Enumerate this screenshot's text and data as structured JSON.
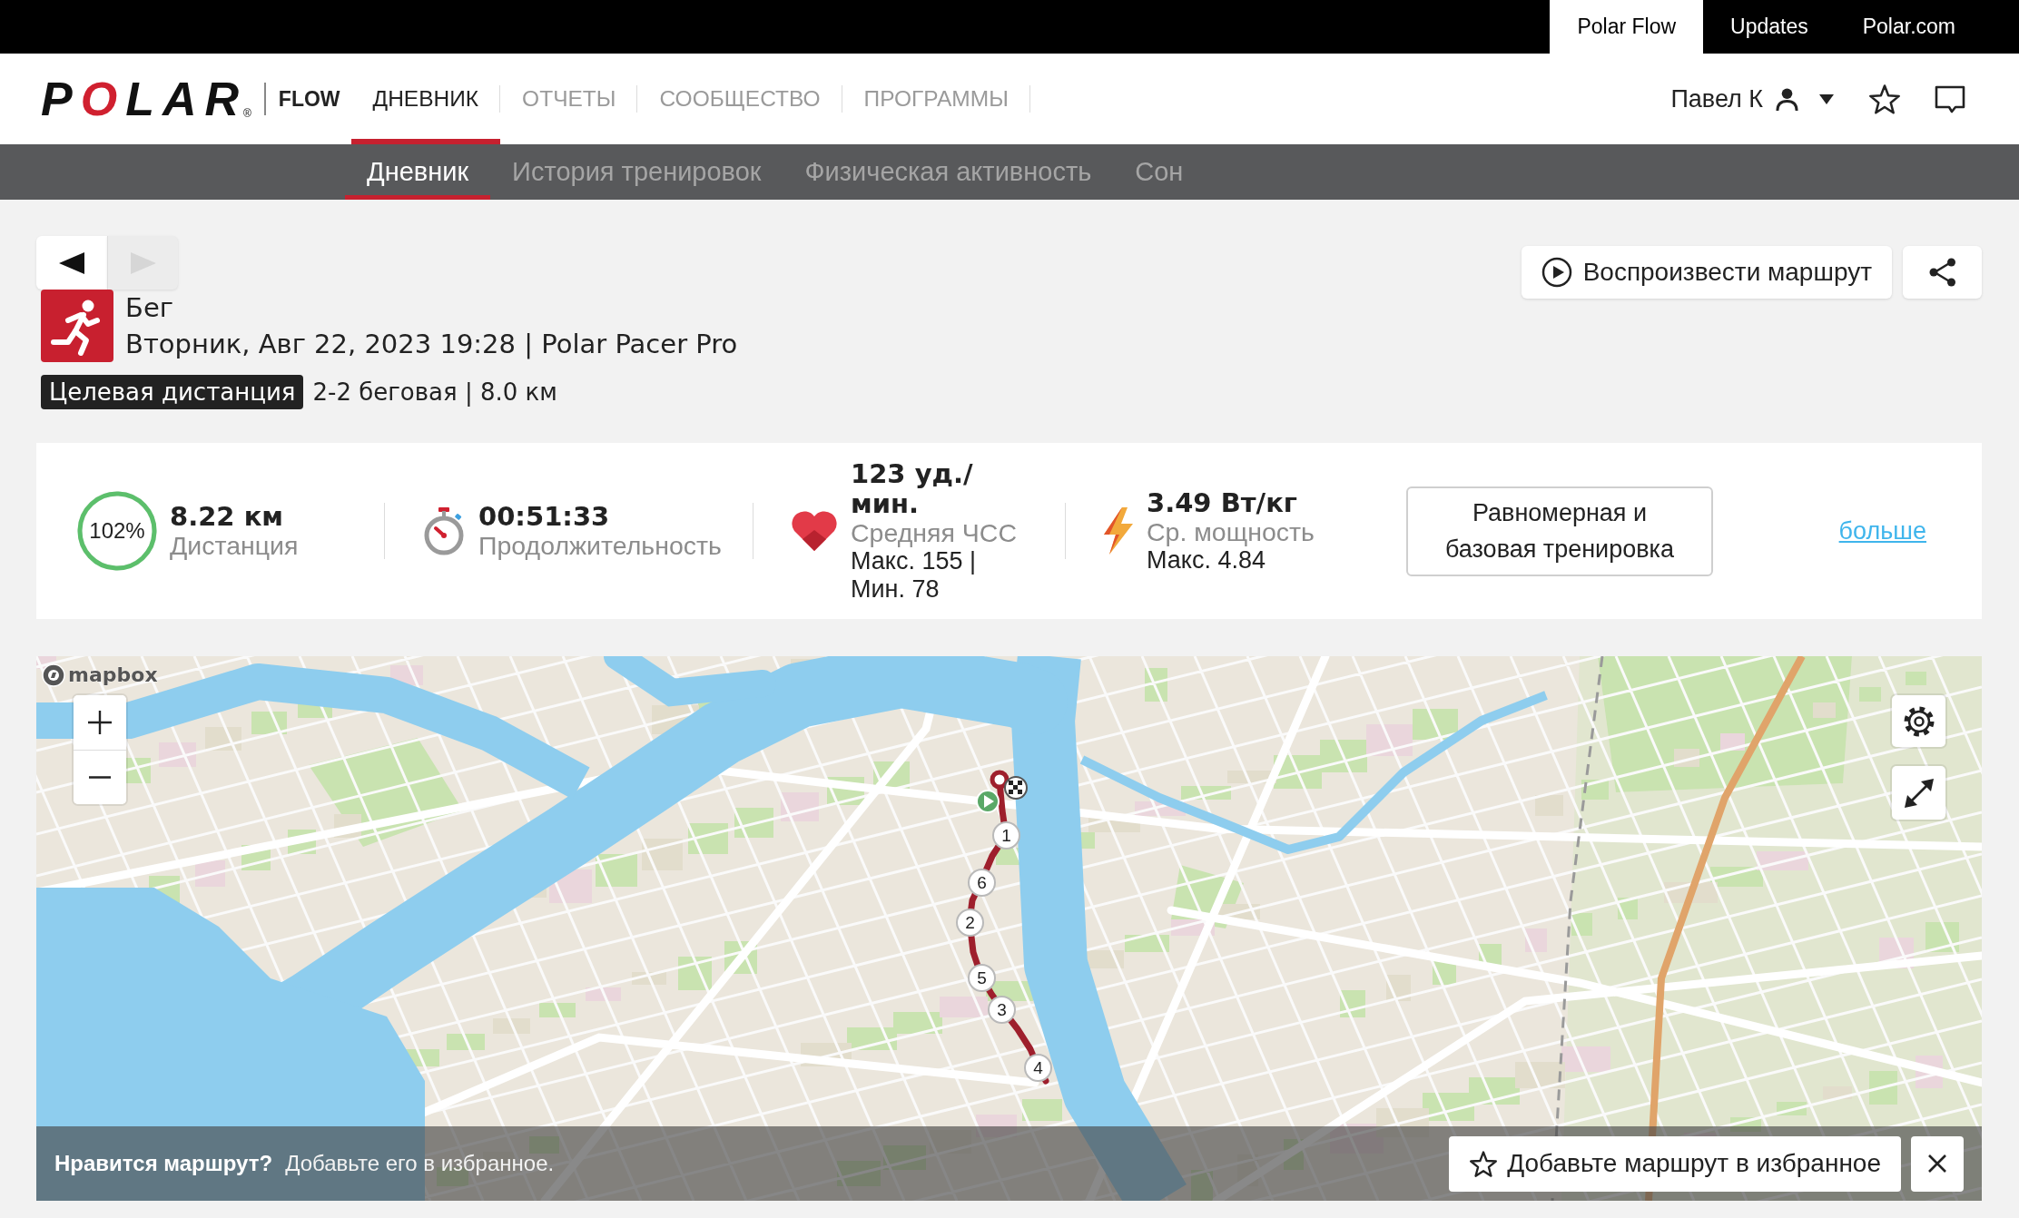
{
  "top_bar": {
    "links": [
      {
        "label": "Polar Flow",
        "selected": true
      },
      {
        "label": "Updates",
        "selected": false
      },
      {
        "label": "Polar.com",
        "selected": false
      }
    ]
  },
  "header": {
    "logo": "POLAR",
    "logo_mark": "®",
    "product": "FLOW",
    "nav": [
      {
        "label": "ДНЕВНИК",
        "selected": true
      },
      {
        "label": "ОТЧЕТЫ",
        "selected": false
      },
      {
        "label": "СООБЩЕСТВО",
        "selected": false
      },
      {
        "label": "ПРОГРАММЫ",
        "selected": false
      }
    ],
    "user": "Павел К"
  },
  "subnav": [
    {
      "label": "Дневник",
      "selected": true
    },
    {
      "label": "История тренировок",
      "selected": false
    },
    {
      "label": "Физическая активность",
      "selected": false
    },
    {
      "label": "Сон",
      "selected": false
    }
  ],
  "pager": [
    {
      "kind": "prev",
      "disabled": false
    },
    {
      "kind": "next",
      "disabled": true
    }
  ],
  "activity": {
    "sport": "Бег",
    "details": "Вторник, Авг 22, 2023 19:28 | Polar Pacer Pro",
    "target_tag": "Целевая дистанция",
    "target": "2-2 беговая | 8.0 км"
  },
  "actions": {
    "replay": "Воспроизвести маршрут"
  },
  "summary": {
    "stats": [
      {
        "kind": "distance",
        "percent": "102%",
        "level": 1,
        "value": "8.22 км",
        "label": "Дистанция"
      },
      {
        "kind": "duration",
        "value": "00:51:33",
        "label": "Продолжительность"
      },
      {
        "kind": "heart_rate",
        "value": "123 уд./мин.",
        "label": "Средняя ЧСС",
        "detail": "Макс. 155 | Мин. 78"
      },
      {
        "kind": "power",
        "value": "3.49 Вт/кг",
        "label": "Ср. мощность",
        "detail": "Макс. 4.84"
      }
    ],
    "benefit": "Равномерная и базовая тренировка",
    "more_link": "больше"
  },
  "map": {
    "provider_logo": "mapbox",
    "laps": [
      "1",
      "6",
      "2",
      "5",
      "3",
      "4"
    ],
    "favorite_bar": {
      "question": "Нравится маршрут?",
      "hint": "Добавьте его в избранное.",
      "button": "Добавьте маршрут в избранное"
    }
  }
}
